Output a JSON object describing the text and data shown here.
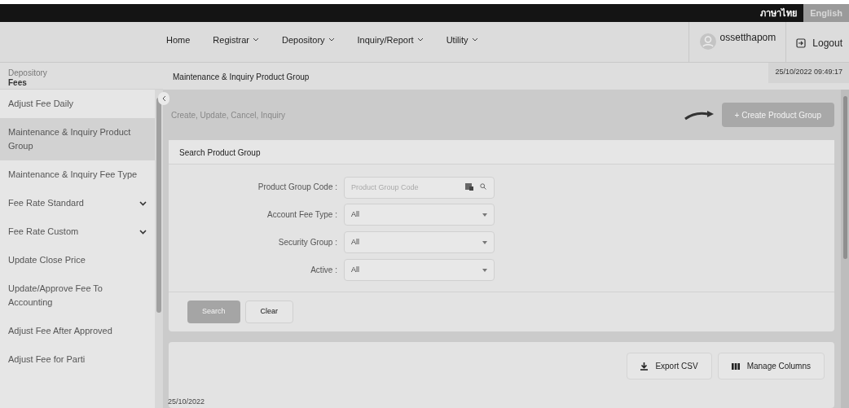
{
  "language_switch": [
    {
      "label": "ภาษาไทย",
      "selected": false
    },
    {
      "label": "English",
      "selected": true
    }
  ],
  "nav": [
    {
      "label": "Home",
      "dropdown": false
    },
    {
      "label": "Registrar",
      "dropdown": true
    },
    {
      "label": "Depository",
      "dropdown": true
    },
    {
      "label": "Inquiry/Report",
      "dropdown": true
    },
    {
      "label": "Utility",
      "dropdown": true
    }
  ],
  "user": {
    "name": "ossetthapom",
    "logout": "Logout"
  },
  "sidebar": {
    "section": "Depository",
    "title": "Fees",
    "items": [
      {
        "label": "Adjust Fee Daily",
        "selected": false,
        "expandable": false
      },
      {
        "label": "Maintenance & Inquiry Product Group",
        "selected": true,
        "expandable": false
      },
      {
        "label": "Maintenance & Inquiry Fee Type",
        "selected": false,
        "expandable": false
      },
      {
        "label": "Fee Rate Standard",
        "selected": false,
        "expandable": true
      },
      {
        "label": "Fee Rate Custom",
        "selected": false,
        "expandable": true
      },
      {
        "label": "Update Close Price",
        "selected": false,
        "expandable": false
      },
      {
        "label": "Update/Approve Fee To Accounting",
        "selected": false,
        "expandable": false
      },
      {
        "label": "Adjust Fee After Approved",
        "selected": false,
        "expandable": false
      },
      {
        "label": "Adjust Fee for Parti",
        "selected": false,
        "expandable": false
      }
    ]
  },
  "page": {
    "title": "Maintenance & Inquiry Product Group",
    "datetime": "25/10/2022 09:49:17",
    "subtitle": "Create, Update, Cancel, Inquiry",
    "create_button": {
      "label": "+ Create Product Group",
      "disabled": true
    }
  },
  "search_card": {
    "title": "Search Product Group",
    "fields": [
      {
        "label": "Product Group Code :",
        "kind": "text",
        "placeholder": "Product Group Code"
      },
      {
        "label": "Account Fee Type :",
        "kind": "select",
        "value": "All"
      },
      {
        "label": "Security Group :",
        "kind": "select",
        "value": "All"
      },
      {
        "label": "Active :",
        "kind": "select",
        "value": "All"
      }
    ],
    "buttons": [
      {
        "label": "Search",
        "disabled": true
      },
      {
        "label": "Clear",
        "disabled": false
      }
    ]
  },
  "results_card": {
    "buttons": [
      {
        "label": "Export CSV",
        "kind": "export"
      },
      {
        "label": "Manage Columns",
        "kind": "columns"
      }
    ]
  },
  "footer_date": "25/10/2022"
}
